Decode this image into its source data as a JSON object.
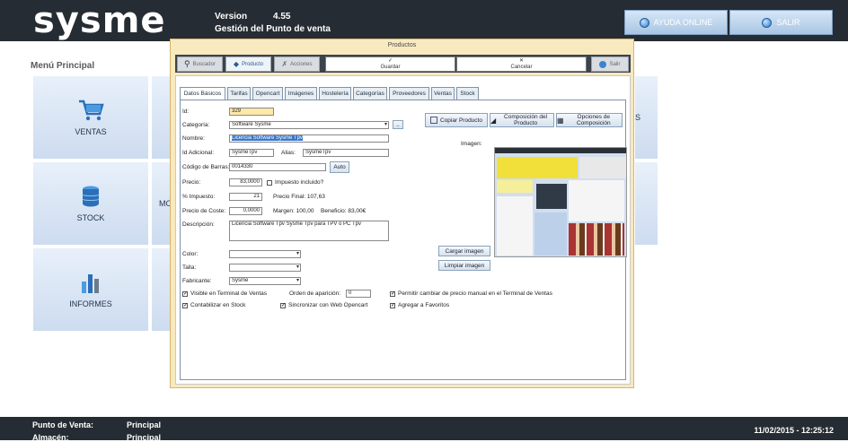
{
  "app": {
    "logo": "sysme",
    "version_label": "Version",
    "version_value": "4.55",
    "subtitle": "Gestión del Punto de venta"
  },
  "top_buttons": {
    "help": "AYUDA ONLINE",
    "exit": "SALIR"
  },
  "menu": {
    "title": "Menú Principal",
    "tiles": [
      {
        "label": "VENTAS"
      },
      {
        "label": "STOCK"
      },
      {
        "label": "INFORMES"
      },
      {
        "label": "MO"
      },
      {
        "label": "S"
      }
    ]
  },
  "footer": {
    "pos_label": "Punto de Venta:",
    "pos_value": "Principal",
    "store_label": "Almacén:",
    "store_value": "Principal",
    "datetime": "11/02/2015 - 12:25:12"
  },
  "window": {
    "title": "Productos",
    "toolbar": {
      "buscador": "Buscador",
      "producto": "Producto",
      "acciones": "Acciones",
      "guardar": "Guardar",
      "cancelar": "Cancelar",
      "salir": "Salir"
    },
    "tabs": [
      "Datos Básicos",
      "Tarifas",
      "Opencart",
      "Imágenes",
      "Hostelería",
      "Categorías",
      "Proveedores",
      "Ventas",
      "Stock"
    ],
    "form": {
      "id_label": "Id:",
      "id_value": "329",
      "categoria_label": "Categoría:",
      "categoria_value": "Software Sysme",
      "nombre_label": "Nombre:",
      "nombre_value": "Licencia Software Sysme Tpv",
      "id_adicional_label": "Id Adicional:",
      "id_adicional_value": "SysmeTpv",
      "alias_label": "Alias:",
      "alias_value": "SysmeTpv",
      "codigo_label": "Código de Barras:",
      "codigo_value": "0014330",
      "auto_button": "Auto",
      "precio_label": "Precio:",
      "precio_value": "83,0000",
      "impuesto_incluido": "Impuesto incluido?",
      "impuesto_label": "% Impuesto:",
      "impuesto_value": "21",
      "precio_final": "Precio Final:  107,63",
      "coste_label": "Precio de Coste:",
      "coste_value": "0,0000",
      "margen": "Margen:  100,00",
      "beneficio": "Beneficio:  83,00€",
      "descripcion_label": "Descripción:",
      "descripcion_value": "Licencia Software Tpv Sysme Tpv para TPV o PC Tpv",
      "color_label": "Color:",
      "talla_label": "Talla:",
      "fabricante_label": "Fabricante:",
      "fabricante_value": "Sysme",
      "copiar_button": "Copiar Producto",
      "composicion_button": "Composición del Producto",
      "opciones_button": "Opciones de Composición",
      "imagen_label": "Imagen:",
      "cargar_button": "Cargar imagen",
      "limpiar_button": "Limpiar imagen",
      "visible_label": "Visible en Terminal de Ventas",
      "orden_label": "Orden de aparición:",
      "orden_value": "0",
      "permitir_label": "Permitir cambiar de precio manual en el Terminal de Ventas",
      "contabilizar_label": "Contabilizar en Stock",
      "sincronizar_label": "Sincronizar con Web Opencart",
      "agregar_label": "Agregar a Favoritos"
    }
  },
  "colors": {
    "bar": "#262c33",
    "tile": "#d3e1f2",
    "window": "#f8e9bf",
    "accent": "#3a77c8"
  }
}
